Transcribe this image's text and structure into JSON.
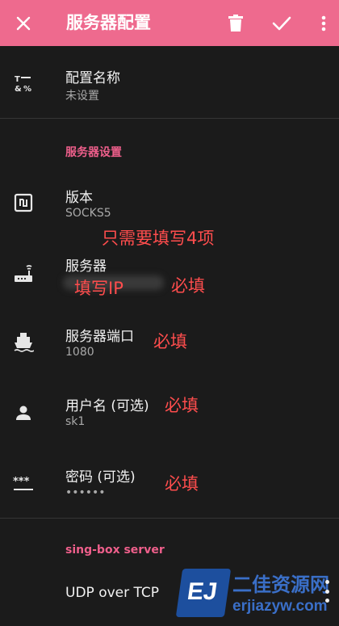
{
  "appbar": {
    "title": "服务器配置",
    "close_icon": "close-icon",
    "delete_icon": "trash-icon",
    "confirm_icon": "check-icon",
    "background": "#ee6a8e"
  },
  "profile": {
    "name_label": "配置名称",
    "name_value": "未设置"
  },
  "server_section": {
    "header": "服务器设置",
    "version_label": "版本",
    "version_value": "SOCKS5",
    "server_label": "服务器",
    "port_label": "服务器端口",
    "port_value": "1080",
    "username_label": "用户名 (可选)",
    "username_value": "sk1",
    "password_label": "密码 (可选)",
    "password_value": "••••••"
  },
  "singbox_section": {
    "header": "sing-box server",
    "udp_label": "UDP over TCP"
  },
  "annotations": {
    "note_four": "只需要填写4项",
    "fill_ip": "填写IP",
    "required_1": "必填",
    "required_2": "必填",
    "required_3": "必填",
    "required_4": "必填"
  },
  "watermark": {
    "logo": "EJ",
    "cn": "二佳资源网",
    "en": "erjiazyw.com"
  },
  "colors": {
    "accent": "#ee6a8e",
    "section": "#ee5f8b",
    "annotation": "#ff4d4d",
    "background": "#1b1b1b"
  }
}
